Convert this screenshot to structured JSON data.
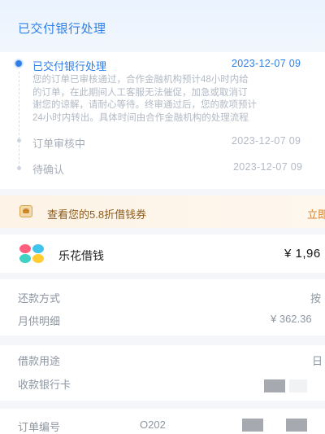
{
  "header": {
    "title": "已交付银行处理"
  },
  "timeline": {
    "steps": [
      {
        "title": "已交付银行处理",
        "time": "2023-12-07 09",
        "description": [
          "您的订单已审核通过，合作金融机构预计48小时内给",
          "的订单，在此期间人工客服无法催促，加急或取消订",
          "谢您的谅解，请耐心等待。终审通过后，您的款项预计",
          "24小时内转出。具体时间由合作金融机构的处理流程"
        ]
      },
      {
        "title": "订单审核中",
        "time": "2023-12-07 09"
      },
      {
        "title": "待确认",
        "time": "2023-12-07 09"
      }
    ]
  },
  "coupon": {
    "text": "查看您的5.8折借钱券",
    "cta": "立即"
  },
  "loan": {
    "product_name": "乐花借钱",
    "amount": "¥ 1,96",
    "rows": [
      {
        "label": "还款方式",
        "value": "按"
      },
      {
        "label": "月供明细",
        "value": "¥ 362.36"
      },
      {
        "label": "借款用途",
        "value": "日"
      },
      {
        "label": "收款银行卡",
        "value": ""
      },
      {
        "label": "订单编号",
        "value": "O202"
      }
    ]
  },
  "colors": {
    "accent": "#2f7fe8",
    "coupon_text": "#8a5a1c",
    "coupon_cta": "#d9822b"
  }
}
